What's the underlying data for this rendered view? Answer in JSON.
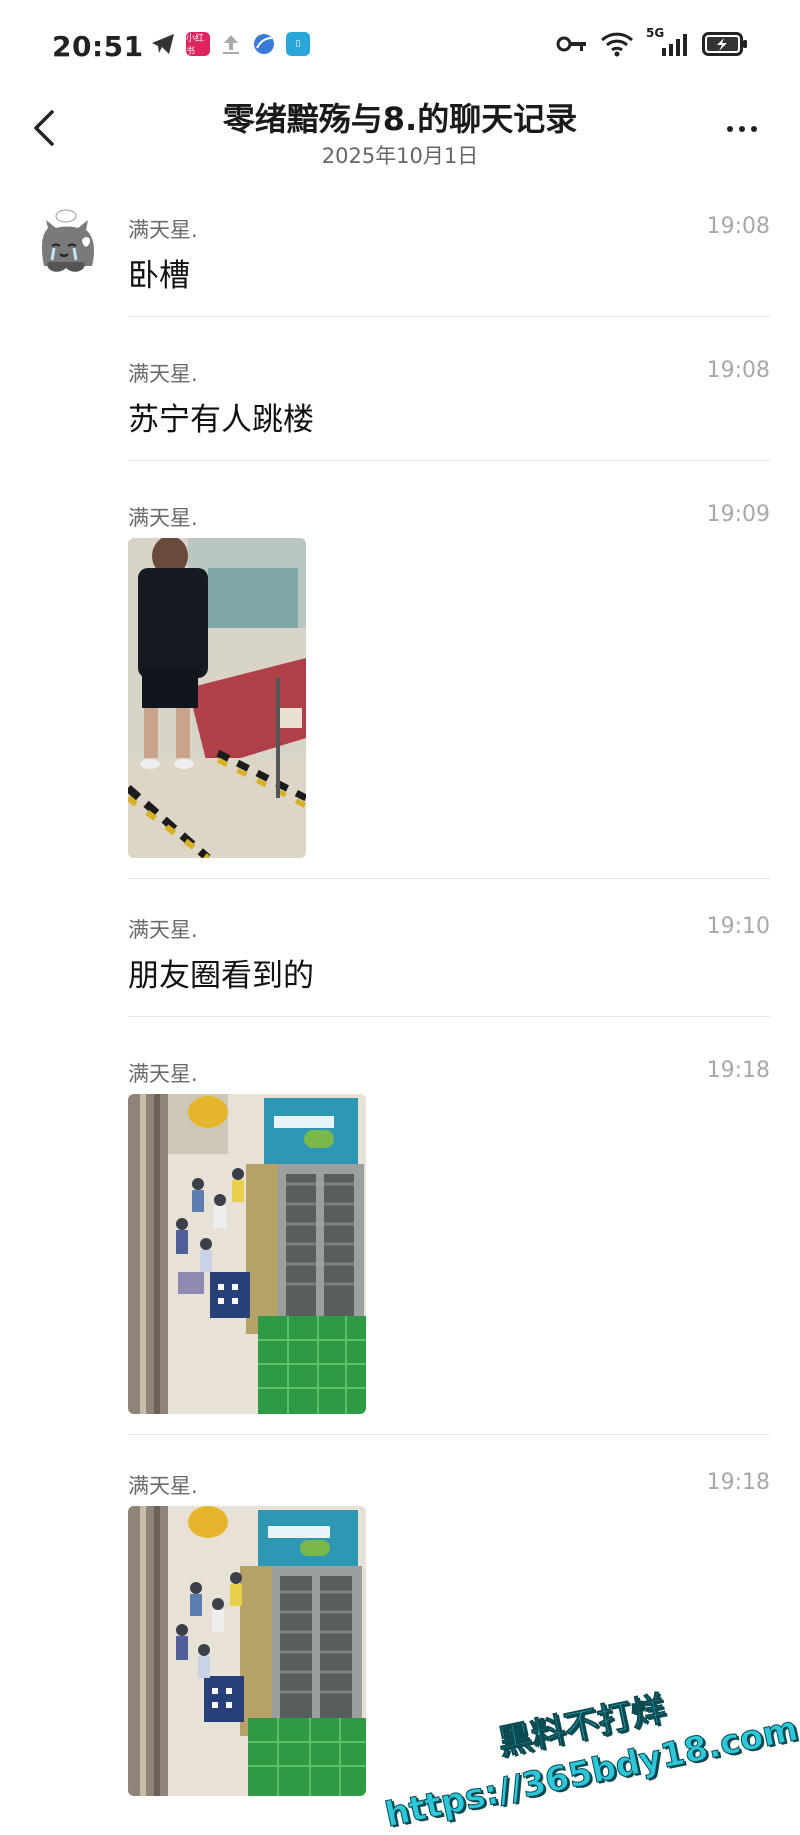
{
  "status_bar": {
    "time": "20:51",
    "network": "5G"
  },
  "header": {
    "title": "零绪黯殇与8.的聊天记录",
    "date": "2025年10月1日"
  },
  "messages": [
    {
      "sender": "满天星.",
      "time": "19:08",
      "text": "卧槽"
    },
    {
      "sender": "满天星.",
      "time": "19:08",
      "text": "苏宁有人跳楼"
    },
    {
      "sender": "满天星.",
      "time": "19:09",
      "text": ""
    },
    {
      "sender": "满天星.",
      "time": "19:10",
      "text": "朋友圈看到的"
    },
    {
      "sender": "满天星.",
      "time": "19:18",
      "text": ""
    },
    {
      "sender": "满天星.",
      "time": "19:18",
      "text": ""
    }
  ],
  "watermark": {
    "line1": "黑料不打烊",
    "line2": "https://365bdy18.com"
  }
}
